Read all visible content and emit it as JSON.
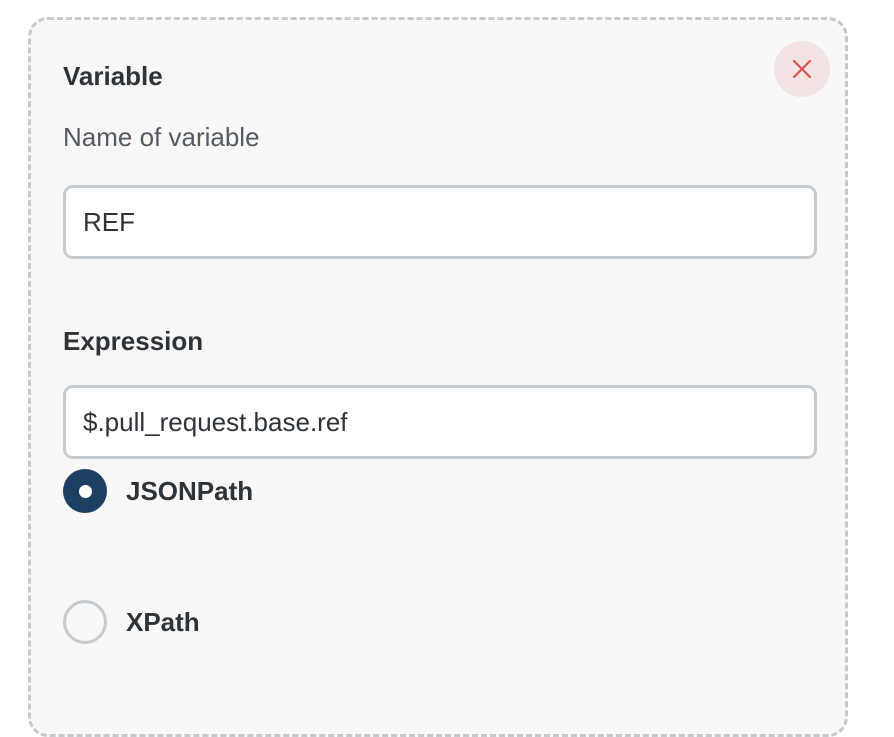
{
  "variable_section": {
    "title": "Variable",
    "helper_text": "Name of variable",
    "name_value": "REF"
  },
  "close_button": {
    "icon": "close-icon",
    "icon_color": "#d9534f",
    "bg_color": "#f3e3e3"
  },
  "expression_section": {
    "title": "Expression",
    "value": "$.pull_request.base.ref",
    "options": [
      {
        "label": "JSONPath",
        "selected": true
      },
      {
        "label": "XPath",
        "selected": false
      }
    ]
  },
  "colors": {
    "accent": "#1d3f61",
    "border": "#c6cbcf",
    "card_background": "#f8f8f8"
  }
}
